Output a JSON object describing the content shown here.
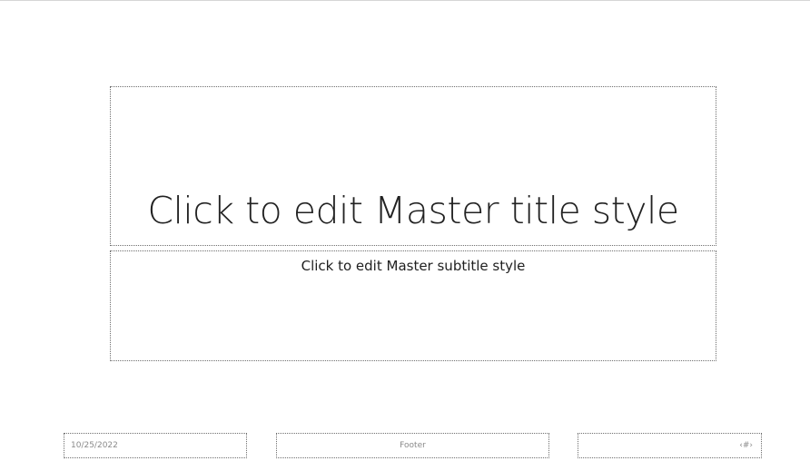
{
  "slide": {
    "title_placeholder": "Click to edit Master title style",
    "subtitle_placeholder": "Click to edit Master subtitle style",
    "date": "10/25/2022",
    "footer": "Footer",
    "slide_number": "‹#›"
  }
}
